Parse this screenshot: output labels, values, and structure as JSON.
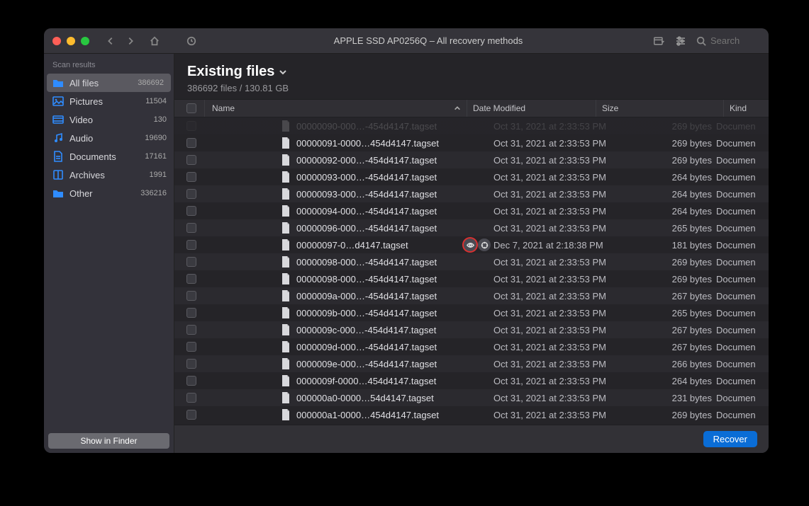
{
  "window_title": "APPLE SSD AP0256Q – All recovery methods",
  "search_placeholder": "Search",
  "sidebar": {
    "heading": "Scan results",
    "items": [
      {
        "label": "All files",
        "count": "386692",
        "icon": "folder",
        "color": "#2f8cff",
        "selected": true
      },
      {
        "label": "Pictures",
        "count": "11504",
        "icon": "image",
        "color": "#2f8cff"
      },
      {
        "label": "Video",
        "count": "130",
        "icon": "video",
        "color": "#2f8cff"
      },
      {
        "label": "Audio",
        "count": "19690",
        "icon": "audio",
        "color": "#2f8cff"
      },
      {
        "label": "Documents",
        "count": "17161",
        "icon": "document",
        "color": "#2f8cff"
      },
      {
        "label": "Archives",
        "count": "1991",
        "icon": "archive",
        "color": "#2f8cff"
      },
      {
        "label": "Other",
        "count": "336216",
        "icon": "folder",
        "color": "#2f8cff"
      }
    ],
    "footer_button": "Show in Finder"
  },
  "main": {
    "title": "Existing files",
    "subtitle": "386692 files / 130.81 GB"
  },
  "columns": {
    "name": "Name",
    "date": "Date Modified",
    "size": "Size",
    "kind": "Kind"
  },
  "rows": [
    {
      "name": "00000090-000…-454d4147.tagset",
      "date": "Oct 31, 2021 at 2:33:53 PM",
      "size": "269 bytes",
      "kind": "Documen",
      "partial": true
    },
    {
      "name": "00000091-0000…454d4147.tagset",
      "date": "Oct 31, 2021 at 2:33:53 PM",
      "size": "269 bytes",
      "kind": "Documen"
    },
    {
      "name": "00000092-000…-454d4147.tagset",
      "date": "Oct 31, 2021 at 2:33:53 PM",
      "size": "269 bytes",
      "kind": "Documen"
    },
    {
      "name": "00000093-000…-454d4147.tagset",
      "date": "Oct 31, 2021 at 2:33:53 PM",
      "size": "264 bytes",
      "kind": "Documen"
    },
    {
      "name": "00000093-000…-454d4147.tagset",
      "date": "Oct 31, 2021 at 2:33:53 PM",
      "size": "264 bytes",
      "kind": "Documen"
    },
    {
      "name": "00000094-000…-454d4147.tagset",
      "date": "Oct 31, 2021 at 2:33:53 PM",
      "size": "264 bytes",
      "kind": "Documen"
    },
    {
      "name": "00000096-000…-454d4147.tagset",
      "date": "Oct 31, 2021 at 2:33:53 PM",
      "size": "265 bytes",
      "kind": "Documen"
    },
    {
      "name": "00000097-0…d4147.tagset",
      "date": "Dec 7, 2021 at 2:18:38 PM",
      "size": "181 bytes",
      "kind": "Documen",
      "highlighted": true
    },
    {
      "name": "00000098-000…-454d4147.tagset",
      "date": "Oct 31, 2021 at 2:33:53 PM",
      "size": "269 bytes",
      "kind": "Documen"
    },
    {
      "name": "00000098-000…-454d4147.tagset",
      "date": "Oct 31, 2021 at 2:33:53 PM",
      "size": "269 bytes",
      "kind": "Documen"
    },
    {
      "name": "0000009a-000…-454d4147.tagset",
      "date": "Oct 31, 2021 at 2:33:53 PM",
      "size": "267 bytes",
      "kind": "Documen"
    },
    {
      "name": "0000009b-000…-454d4147.tagset",
      "date": "Oct 31, 2021 at 2:33:53 PM",
      "size": "265 bytes",
      "kind": "Documen"
    },
    {
      "name": "0000009c-000…-454d4147.tagset",
      "date": "Oct 31, 2021 at 2:33:53 PM",
      "size": "267 bytes",
      "kind": "Documen"
    },
    {
      "name": "0000009d-000…-454d4147.tagset",
      "date": "Oct 31, 2021 at 2:33:53 PM",
      "size": "267 bytes",
      "kind": "Documen"
    },
    {
      "name": "0000009e-000…-454d4147.tagset",
      "date": "Oct 31, 2021 at 2:33:53 PM",
      "size": "266 bytes",
      "kind": "Documen"
    },
    {
      "name": "0000009f-0000…454d4147.tagset",
      "date": "Oct 31, 2021 at 2:33:53 PM",
      "size": "264 bytes",
      "kind": "Documen"
    },
    {
      "name": "000000a0-0000…54d4147.tagset",
      "date": "Oct 31, 2021 at 2:33:53 PM",
      "size": "231 bytes",
      "kind": "Documen"
    },
    {
      "name": "000000a1-0000…454d4147.tagset",
      "date": "Oct 31, 2021 at 2:33:53 PM",
      "size": "269 bytes",
      "kind": "Documen"
    }
  ],
  "recover_label": "Recover"
}
